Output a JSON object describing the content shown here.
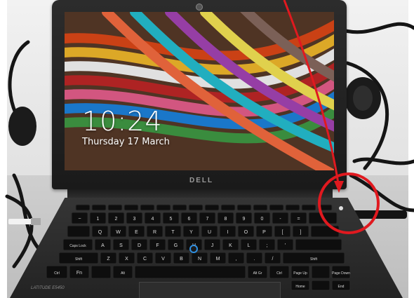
{
  "lock_screen": {
    "time": "10:24",
    "date": "Thursday 17 March"
  },
  "laptop": {
    "brand": "DELL",
    "model": "LATITUDE E5450"
  },
  "keyboard": {
    "row_numbers": [
      "~",
      "1",
      "2",
      "3",
      "4",
      "5",
      "6",
      "7",
      "8",
      "9",
      "0",
      "-",
      "="
    ],
    "row_q": [
      "Q",
      "W",
      "E",
      "R",
      "T",
      "Y",
      "U",
      "I",
      "O",
      "P",
      "[",
      "]"
    ],
    "row_a": [
      "A",
      "S",
      "D",
      "F",
      "G",
      "H",
      "J",
      "K",
      "L",
      ";",
      "'"
    ],
    "row_z": [
      "Z",
      "X",
      "C",
      "V",
      "B",
      "N",
      "M",
      ",",
      ".",
      "/"
    ],
    "caps_lock": "Caps Lock",
    "shift": "Shift",
    "ctrl": "Ctrl",
    "fn": "Fn",
    "alt": "Alt",
    "alt_gr": "Alt Gr",
    "page_up": "Page Up",
    "page_down": "Page Down",
    "home": "Home",
    "end": "End"
  },
  "annotation": {
    "color": "#e0191f",
    "target": "power-button"
  },
  "colors": {
    "lid": "#1f1f1f",
    "pointstick": "#2f8fe0"
  }
}
